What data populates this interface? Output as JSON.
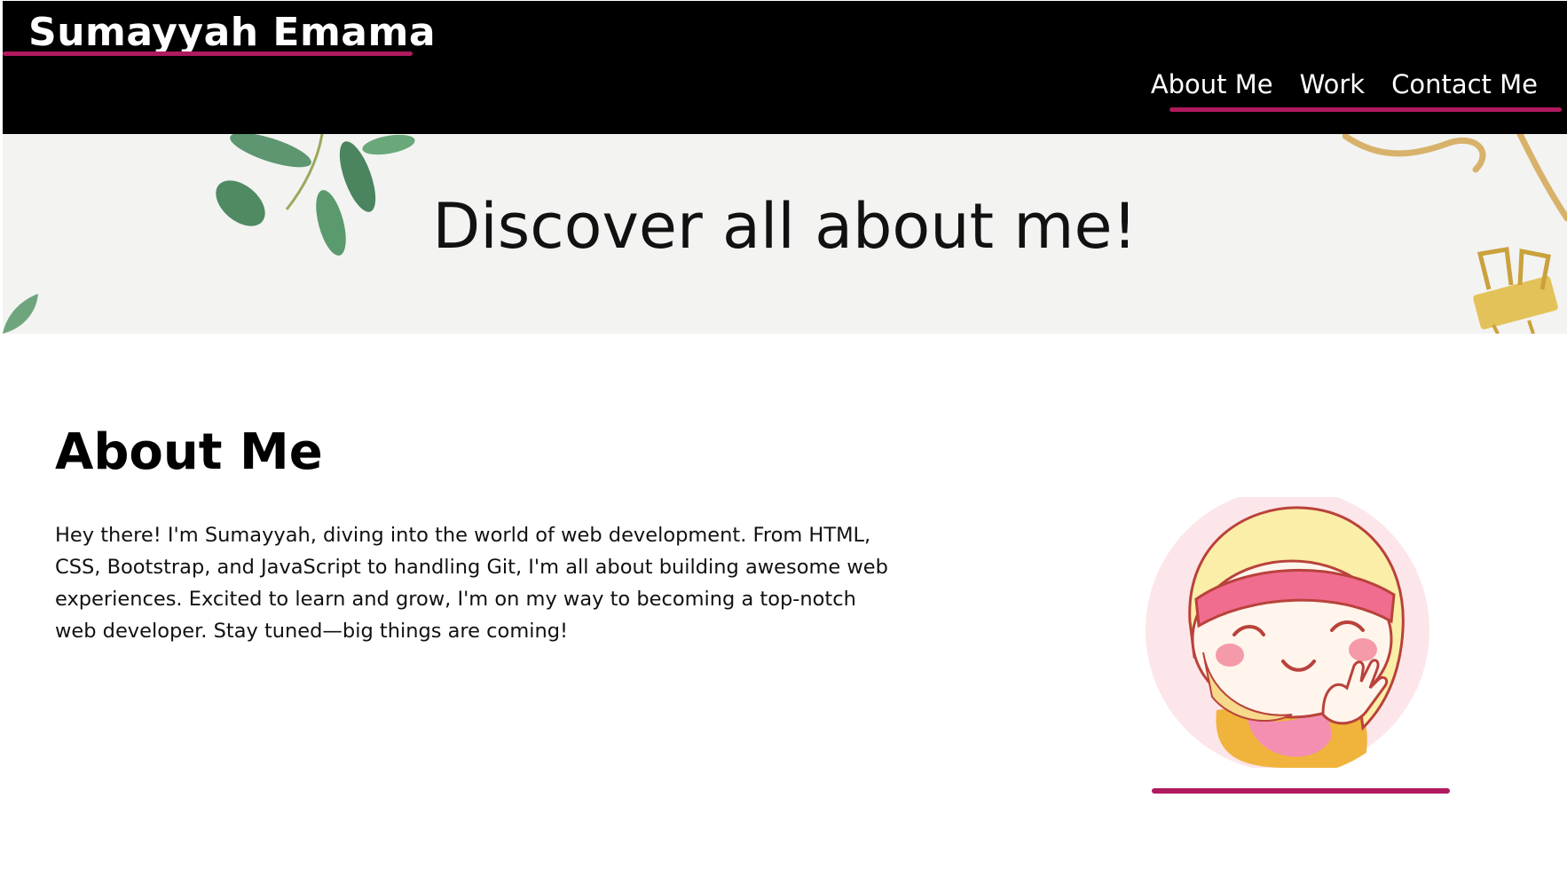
{
  "header": {
    "brand": "Sumayyah Emama",
    "nav": [
      {
        "label": "About Me"
      },
      {
        "label": "Work"
      },
      {
        "label": "Contact Me"
      }
    ]
  },
  "hero": {
    "title": "Discover all about me!"
  },
  "about": {
    "heading": "About Me",
    "text": "Hey there! I'm Sumayyah, diving into the world of web development. From HTML, CSS, Bootstrap, and JavaScript to handling Git, I'm all about building awesome web experiences. Excited to learn and grow, I'm on my way to becoming a top-notch web developer. Stay tuned—big things are coming!"
  },
  "colors": {
    "header_bg": "#000000",
    "accent": "#b01a5e",
    "hero_bg": "#f3f3f2"
  }
}
